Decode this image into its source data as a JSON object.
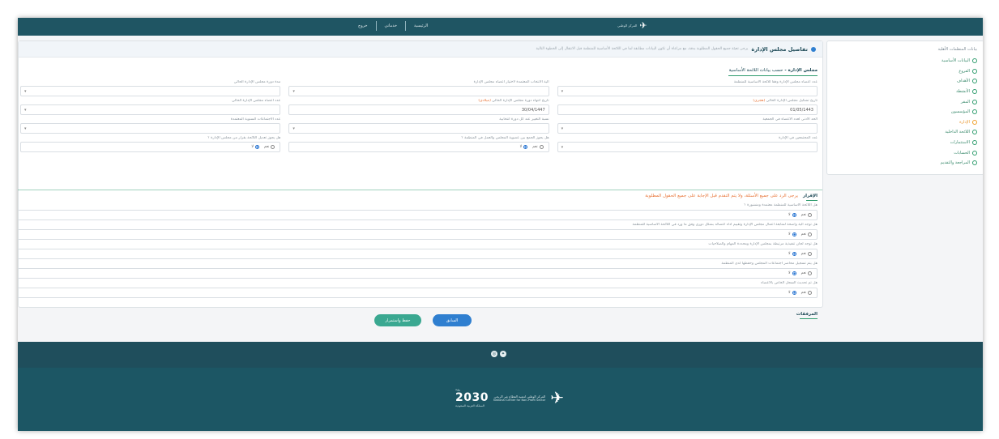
{
  "header": {
    "logo_text": "المركز الوطني",
    "nav": [
      "الرئيسية",
      "خدماتي",
      "خروج"
    ]
  },
  "steps_panel": {
    "title": "بيانات المنظمات الأهلية",
    "items": [
      {
        "label": "البيانات الأساسية",
        "state": "done"
      },
      {
        "label": "الفروع",
        "state": "done"
      },
      {
        "label": "الأهداف",
        "state": "done"
      },
      {
        "label": "الأنشطة",
        "state": "done"
      },
      {
        "label": "المقر",
        "state": "done"
      },
      {
        "label": "المؤسسون",
        "state": "done"
      },
      {
        "label": "الإدارة",
        "state": "active"
      },
      {
        "label": "اللائحة الداخلية",
        "state": "done"
      },
      {
        "label": "الاستثمارات",
        "state": "done"
      },
      {
        "label": "الحسابات",
        "state": "done"
      },
      {
        "label": "المراجعة والتقديم",
        "state": "done"
      }
    ]
  },
  "notice": {
    "title": "تفاصيل مجلس الإدارة",
    "text": "يرجى تعبئة جميع الحقول المطلوبة بدقة، مع مراعاة أن تكون البيانات مطابقة لما في اللائحة الأساسية للمنظمة قبل الانتقال إلى الخطوة التالية"
  },
  "section": {
    "title": "مجلس الإدارة",
    "subtitle": "حسب بيانات اللائحة الأساسية"
  },
  "fields": [
    [
      {
        "label": "عدد أعضاء مجلس الإدارة وفقاً للائحة الأساسية للمنظمة",
        "value": "",
        "type": "select"
      },
      {
        "label": "آلية الانتخاب المعتمدة لاختيار أعضاء مجلس الإدارة",
        "value": "",
        "type": "select"
      },
      {
        "label": "مدة دورة مجلس الإدارة الحالي",
        "value": "",
        "type": "select"
      }
    ],
    [
      {
        "label": "تاريخ تشكيل مجلس الإدارة الحالي",
        "req": "(هجري)",
        "value": "01/05/1443",
        "type": "text"
      },
      {
        "label": "تاريخ انتهاء دورة مجلس الإدارة الحالي",
        "req": "(ميلادي)",
        "value": "30/04/1447",
        "type": "text"
      },
      {
        "label": "عدد أعضاء مجلس الإدارة الحالي",
        "value": "",
        "type": "select"
      }
    ],
    [
      {
        "label": "الحد الأدنى لعدد الأعضاء في الجمعية",
        "value": "",
        "type": "select"
      },
      {
        "label": "نسبة التغيير عند كل دورة انتخابية",
        "value": "",
        "type": "select"
      },
      {
        "label": "عدد الاجتماعات السنوية المعتمدة",
        "value": "",
        "type": "select"
      }
    ],
    [
      {
        "label": "عدد المجتمعين في الإدارة",
        "value": "",
        "type": "select"
      },
      {
        "label": "هل يجوز الجمع بين عضوية المجلس والعمل في المنظمة ؟",
        "type": "radio",
        "yes": "نعم",
        "no": "لا",
        "selected": "no"
      },
      {
        "label": "هل يجوز تعديل اللائحة بقرار من مجلس الإدارة ؟",
        "type": "radio",
        "yes": "نعم",
        "no": "لا",
        "selected": "no"
      }
    ]
  ],
  "notes": {
    "title": "الإقرار",
    "warning": "يرجى الرد على جميع الأسئلة، ولا يتم التقدم قبل الإجابة على جميع الحقول المطلوبة"
  },
  "questions": [
    {
      "text": "هل اللائحة الأساسية للمنظمة معتمدة ومنشورة ؟",
      "yes": "نعم",
      "no": "لا",
      "selected": "no"
    },
    {
      "text": "هل توجد آلية واضحة لمتابعة أعمال مجلس الإدارة وتقييم أداء أعضائه بشكل دوري وفق ما ورد في اللائحة الأساسية للمنظمة",
      "yes": "نعم",
      "no": "لا",
      "selected": "no"
    },
    {
      "text": "هل توجد لجان تنفيذية مرتبطة بمجلس الإدارة ومحددة المهام والصلاحيات",
      "yes": "نعم",
      "no": "لا",
      "selected": "no"
    },
    {
      "text": "هل يتم تسجيل محاضر اجتماعات المجلس وحفظها لدى المنظمة",
      "yes": "نعم",
      "no": "لا",
      "selected": "no"
    },
    {
      "text": "هل تم تحديث السجل الخاص بالأعضاء",
      "yes": "نعم",
      "no": "لا",
      "selected": "no"
    }
  ],
  "attachments_label": "المرفقات",
  "buttons": {
    "prev": "السابق",
    "save": "حفظ واستمرار"
  },
  "footer": {
    "vision": "2030",
    "vision_ar": "رؤية",
    "vision_sub": "المملكة العربية السعودية",
    "ncnp_ar": "المركز الوطني لتنمية القطاع غير الربحي",
    "ncnp_en": "National Center for Non-Profit Sector"
  },
  "colors": {
    "header": "#1f5563",
    "accent_green": "#2e9c6d",
    "save_button": "#3aa891",
    "prev_button": "#2f7fd0",
    "footer_top": "#1f4e5c",
    "footer_bottom": "#1c5664"
  }
}
